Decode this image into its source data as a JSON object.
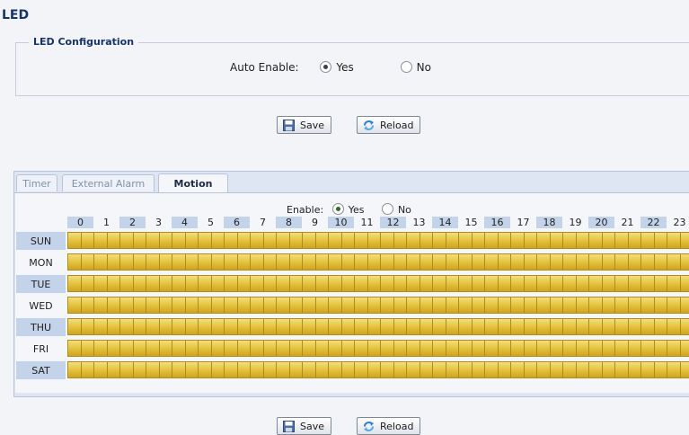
{
  "page": {
    "title": "LED"
  },
  "led_config": {
    "legend": "LED Configuration",
    "auto_enable_label": "Auto Enable:",
    "options": [
      "Yes",
      "No"
    ],
    "selected": "Yes"
  },
  "buttons": {
    "save": "Save",
    "reload": "Reload"
  },
  "tabs": [
    {
      "label": "Timer",
      "active": false
    },
    {
      "label": "External Alarm",
      "active": false
    },
    {
      "label": "Motion",
      "active": true
    }
  ],
  "motion": {
    "enable_label": "Enable:",
    "options": [
      "Yes",
      "No"
    ],
    "selected": "Yes",
    "hours": [
      "0",
      "1",
      "2",
      "3",
      "4",
      "5",
      "6",
      "7",
      "8",
      "9",
      "10",
      "11",
      "12",
      "13",
      "14",
      "15",
      "16",
      "17",
      "18",
      "19",
      "20",
      "21",
      "22",
      "23"
    ],
    "days": [
      "SUN",
      "MON",
      "TUE",
      "WED",
      "THU",
      "FRI",
      "SAT"
    ],
    "all_slots_selected": true,
    "slot_color": "#e3c03a"
  }
}
